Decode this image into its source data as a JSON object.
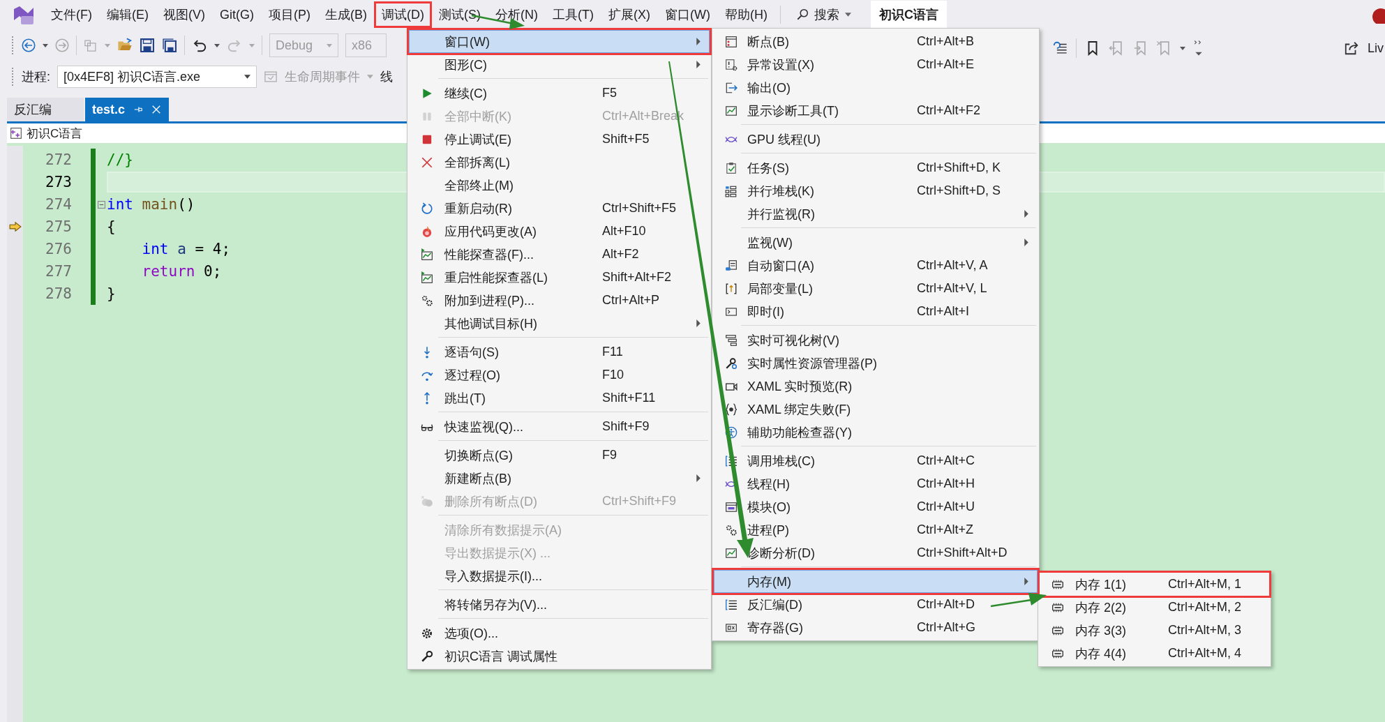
{
  "menubar": {
    "items": [
      {
        "label": "文件(F)",
        "annotated": false
      },
      {
        "label": "编辑(E)",
        "annotated": false
      },
      {
        "label": "视图(V)",
        "annotated": false
      },
      {
        "label": "Git(G)",
        "annotated": false
      },
      {
        "label": "项目(P)",
        "annotated": false
      },
      {
        "label": "生成(B)",
        "annotated": false
      },
      {
        "label": "调试(D)",
        "annotated": true
      },
      {
        "label": "测试(S)",
        "annotated": false
      },
      {
        "label": "分析(N)",
        "annotated": false
      },
      {
        "label": "工具(T)",
        "annotated": false
      },
      {
        "label": "扩展(X)",
        "annotated": false
      },
      {
        "label": "窗口(W)",
        "annotated": false
      },
      {
        "label": "帮助(H)",
        "annotated": false
      }
    ],
    "search": "搜索",
    "solution_title": "初识C语言"
  },
  "toolbar": {
    "configuration": "Debug",
    "platform": "x86",
    "share_label": "Liv"
  },
  "process_bar": {
    "label": "进程:",
    "process": "[0x4EF8] 初识C语言.exe",
    "lifecycle": "生命周期事件",
    "thread_label": "线"
  },
  "tabs": [
    {
      "label": "反汇编",
      "selected": false
    },
    {
      "label": "test.c",
      "selected": true
    }
  ],
  "breadcrumb": "初识C语言",
  "editor": {
    "lines": [
      {
        "number": "272",
        "current": false,
        "foldable": false,
        "execution": false,
        "tokens": [
          {
            "kind": "comment",
            "text": "//}"
          }
        ]
      },
      {
        "number": "273",
        "current": true,
        "foldable": false,
        "execution": false
      },
      {
        "number": "274",
        "current": false,
        "foldable": true,
        "execution": false,
        "tokens": [
          {
            "kind": "keyword",
            "text": "int"
          },
          {
            "kind": "function",
            "text": " main"
          },
          {
            "kind": "plain",
            "text": "()"
          }
        ]
      },
      {
        "number": "275",
        "current": false,
        "foldable": false,
        "execution": true,
        "tokens": [
          {
            "kind": "plain",
            "text": "{"
          }
        ]
      },
      {
        "number": "276",
        "current": false,
        "foldable": false,
        "execution": false,
        "tokens": [
          {
            "kind": "keyword",
            "text": "    int"
          },
          {
            "kind": "variable",
            "text": " a"
          },
          {
            "kind": "plain",
            "text": " = 4;"
          }
        ]
      },
      {
        "number": "277",
        "current": false,
        "foldable": false,
        "execution": false,
        "tokens": [
          {
            "kind": "control",
            "text": "    return"
          },
          {
            "kind": "plain",
            "text": " 0;"
          }
        ]
      },
      {
        "number": "278",
        "current": false,
        "foldable": false,
        "execution": false,
        "tokens": [
          {
            "kind": "plain",
            "text": "}"
          }
        ]
      }
    ]
  },
  "debug_menu": {
    "groups": [
      [
        {
          "label": "窗口(W)",
          "disabled": false,
          "submenu": true,
          "selected": true,
          "annotated": true
        },
        {
          "label": "图形(C)",
          "disabled": false,
          "submenu": true,
          "selected": false,
          "annotated": false
        }
      ],
      [
        {
          "label": "继续(C)",
          "shortcut": "F5",
          "kind": "play",
          "disabled": false,
          "submenu": false,
          "selected": false,
          "annotated": false
        },
        {
          "label": "全部中断(K)",
          "shortcut": "Ctrl+Alt+Break",
          "kind": "pause",
          "disabled": true,
          "submenu": false,
          "selected": false,
          "annotated": false
        },
        {
          "label": "停止调试(E)",
          "shortcut": "Shift+F5",
          "kind": "stop",
          "disabled": false,
          "submenu": false,
          "selected": false,
          "annotated": false
        },
        {
          "label": "全部拆离(L)",
          "kind": "cross",
          "disabled": false,
          "submenu": false,
          "selected": false,
          "annotated": false
        },
        {
          "label": "全部终止(M)",
          "disabled": false,
          "submenu": false,
          "selected": false,
          "annotated": false
        },
        {
          "label": "重新启动(R)",
          "shortcut": "Ctrl+Shift+F5",
          "kind": "restart",
          "disabled": false,
          "submenu": false,
          "selected": false,
          "annotated": false
        },
        {
          "label": "应用代码更改(A)",
          "shortcut": "Alt+F10",
          "kind": "flame",
          "disabled": false,
          "submenu": false,
          "selected": false,
          "annotated": false
        },
        {
          "label": "性能探查器(F)...",
          "shortcut": "Alt+F2",
          "kind": "perf",
          "disabled": false,
          "submenu": false,
          "selected": false,
          "annotated": false
        },
        {
          "label": "重启性能探查器(L)",
          "shortcut": "Shift+Alt+F2",
          "kind": "perf",
          "disabled": false,
          "submenu": false,
          "selected": false,
          "annotated": false
        },
        {
          "label": "附加到进程(P)...",
          "shortcut": "Ctrl+Alt+P",
          "kind": "gears",
          "disabled": false,
          "submenu": false,
          "selected": false,
          "annotated": false
        },
        {
          "label": "其他调试目标(H)",
          "disabled": false,
          "submenu": true,
          "selected": false,
          "annotated": false
        }
      ],
      [
        {
          "label": "逐语句(S)",
          "shortcut": "F11",
          "kind": "step-into",
          "disabled": false,
          "submenu": false,
          "selected": false,
          "annotated": false
        },
        {
          "label": "逐过程(O)",
          "shortcut": "F10",
          "kind": "step-over",
          "disabled": false,
          "submenu": false,
          "selected": false,
          "annotated": false
        },
        {
          "label": "跳出(T)",
          "shortcut": "Shift+F11",
          "kind": "step-out",
          "disabled": false,
          "submenu": false,
          "selected": false,
          "annotated": false
        }
      ],
      [
        {
          "label": "快速监视(Q)...",
          "shortcut": "Shift+F9",
          "kind": "glasses",
          "disabled": false,
          "submenu": false,
          "selected": false,
          "annotated": false
        }
      ],
      [
        {
          "label": "切换断点(G)",
          "shortcut": "F9",
          "disabled": false,
          "submenu": false,
          "selected": false,
          "annotated": false
        },
        {
          "label": "新建断点(B)",
          "disabled": false,
          "submenu": true,
          "selected": false,
          "annotated": false
        },
        {
          "label": "删除所有断点(D)",
          "shortcut": "Ctrl+Shift+F9",
          "kind": "bp-delete",
          "disabled": true,
          "submenu": false,
          "selected": false,
          "annotated": false
        }
      ],
      [
        {
          "label": "清除所有数据提示(A)",
          "disabled": true,
          "submenu": false,
          "selected": false,
          "annotated": false
        },
        {
          "label": "导出数据提示(X) ...",
          "disabled": true,
          "submenu": false,
          "selected": false,
          "annotated": false
        },
        {
          "label": "导入数据提示(I)...",
          "disabled": false,
          "submenu": false,
          "selected": false,
          "annotated": false
        }
      ],
      [
        {
          "label": "将转储另存为(V)...",
          "disabled": false,
          "submenu": false,
          "selected": false,
          "annotated": false
        }
      ],
      [
        {
          "label": "选项(O)...",
          "kind": "gear",
          "disabled": false,
          "submenu": false,
          "selected": false,
          "annotated": false
        },
        {
          "label": "初识C语言 调试属性",
          "kind": "wrench",
          "disabled": false,
          "submenu": false,
          "selected": false,
          "annotated": false
        }
      ]
    ]
  },
  "window_menu": {
    "groups": [
      [
        {
          "label": "断点(B)",
          "shortcut": "Ctrl+Alt+B",
          "kind": "breakpoints",
          "submenu": false,
          "selected": false,
          "annotated": false
        },
        {
          "label": "异常设置(X)",
          "shortcut": "Ctrl+Alt+E",
          "kind": "exception",
          "submenu": false,
          "selected": false,
          "annotated": false
        },
        {
          "label": "输出(O)",
          "kind": "output",
          "submenu": false,
          "selected": false,
          "annotated": false
        },
        {
          "label": "显示诊断工具(T)",
          "shortcut": "Ctrl+Alt+F2",
          "kind": "diag",
          "submenu": false,
          "selected": false,
          "annotated": false
        }
      ],
      [
        {
          "label": "GPU 线程(U)",
          "kind": "wave",
          "submenu": false,
          "selected": false,
          "annotated": false
        }
      ],
      [
        {
          "label": "任务(S)",
          "shortcut": "Ctrl+Shift+D, K",
          "kind": "task",
          "submenu": false,
          "selected": false,
          "annotated": false
        },
        {
          "label": "并行堆栈(K)",
          "shortcut": "Ctrl+Shift+D, S",
          "kind": "pstack",
          "submenu": false,
          "selected": false,
          "annotated": false
        },
        {
          "label": "并行监视(R)",
          "submenu": true,
          "selected": false,
          "annotated": false
        }
      ],
      [
        {
          "label": "监视(W)",
          "submenu": true,
          "selected": false,
          "annotated": false
        },
        {
          "label": "自动窗口(A)",
          "shortcut": "Ctrl+Alt+V, A",
          "kind": "autos",
          "submenu": false,
          "selected": false,
          "annotated": false
        },
        {
          "label": "局部变量(L)",
          "shortcut": "Ctrl+Alt+V, L",
          "kind": "locals",
          "submenu": false,
          "selected": false,
          "annotated": false
        },
        {
          "label": "即时(I)",
          "shortcut": "Ctrl+Alt+I",
          "kind": "immediate",
          "submenu": false,
          "selected": false,
          "annotated": false
        }
      ],
      [
        {
          "label": "实时可视化树(V)",
          "kind": "tree",
          "submenu": false,
          "selected": false,
          "annotated": false
        },
        {
          "label": "实时属性资源管理器(P)",
          "kind": "props",
          "submenu": false,
          "selected": false,
          "annotated": false
        },
        {
          "label": "XAML 实时预览(R)",
          "kind": "camera",
          "submenu": false,
          "selected": false,
          "annotated": false
        },
        {
          "label": "XAML 绑定失败(F)",
          "kind": "braces",
          "submenu": false,
          "selected": false,
          "annotated": false
        },
        {
          "label": "辅助功能检查器(Y)",
          "kind": "access",
          "submenu": false,
          "selected": false,
          "annotated": false
        }
      ],
      [
        {
          "label": "调用堆栈(C)",
          "shortcut": "Ctrl+Alt+C",
          "kind": "callstack",
          "submenu": false,
          "selected": false,
          "annotated": false
        },
        {
          "label": "线程(H)",
          "shortcut": "Ctrl+Alt+H",
          "kind": "wave",
          "submenu": false,
          "selected": false,
          "annotated": false
        },
        {
          "label": "模块(O)",
          "shortcut": "Ctrl+Alt+U",
          "kind": "modules",
          "submenu": false,
          "selected": false,
          "annotated": false
        },
        {
          "label": "进程(P)",
          "shortcut": "Ctrl+Alt+Z",
          "kind": "gears",
          "submenu": false,
          "selected": false,
          "annotated": false
        },
        {
          "label": "诊断分析(D)",
          "shortcut": "Ctrl+Shift+Alt+D",
          "kind": "diag",
          "submenu": false,
          "selected": false,
          "annotated": false
        }
      ],
      [
        {
          "label": "内存(M)",
          "submenu": true,
          "selected": true,
          "annotated": true
        },
        {
          "label": "反汇编(D)",
          "shortcut": "Ctrl+Alt+D",
          "kind": "callstack",
          "submenu": false,
          "selected": false,
          "annotated": false
        },
        {
          "label": "寄存器(G)",
          "shortcut": "Ctrl+Alt+G",
          "kind": "registers",
          "submenu": false,
          "selected": false,
          "annotated": false
        }
      ]
    ]
  },
  "memory_menu": {
    "groups": [
      [
        {
          "label": "内存 1(1)",
          "shortcut": "Ctrl+Alt+M, 1",
          "kind": "chip",
          "annotated": true
        },
        {
          "label": "内存 2(2)",
          "shortcut": "Ctrl+Alt+M, 2",
          "kind": "chip",
          "annotated": false
        },
        {
          "label": "内存 3(3)",
          "shortcut": "Ctrl+Alt+M, 3",
          "kind": "chip",
          "annotated": false
        },
        {
          "label": "内存 4(4)",
          "shortcut": "Ctrl+Alt+M, 4",
          "kind": "chip",
          "annotated": false
        }
      ]
    ]
  }
}
